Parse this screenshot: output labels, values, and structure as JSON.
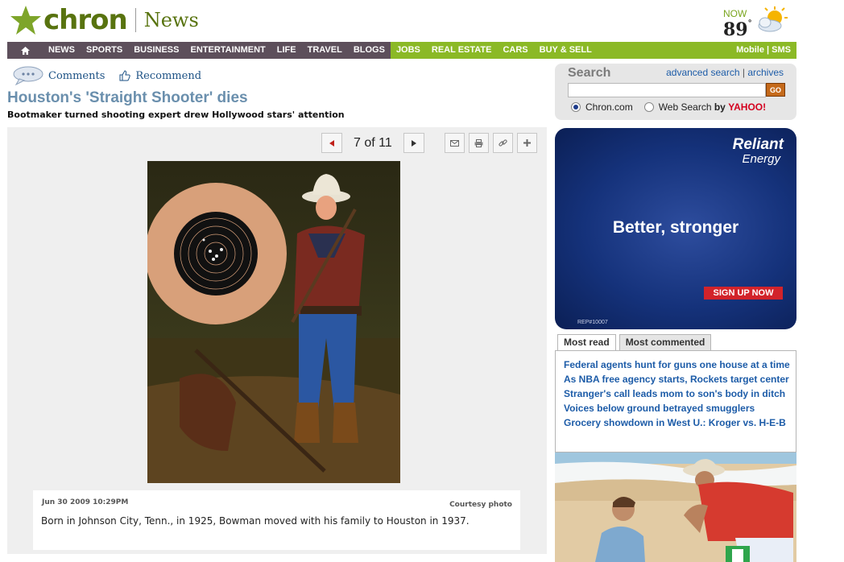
{
  "header": {
    "logo_text": "chron",
    "section": "News",
    "weather_label": "NOW",
    "weather_temp": "89",
    "weather_deg": "°",
    "weather_icon": "partly-sunny-icon"
  },
  "nav": {
    "left_items": [
      "NEWS",
      "SPORTS",
      "BUSINESS",
      "ENTERTAINMENT",
      "LIFE",
      "TRAVEL",
      "BLOGS"
    ],
    "right_items": [
      "JOBS",
      "REAL ESTATE",
      "CARS",
      "BUY & SELL"
    ],
    "mobile": "Mobile | SMS",
    "home_icon": "home-icon"
  },
  "tools": {
    "comments": "Comments",
    "recommend": "Recommend"
  },
  "article": {
    "headline": "Houston's 'Straight Shooter' dies",
    "deck": "Bootmaker turned shooting expert drew Hollywood stars' attention"
  },
  "gallery": {
    "count": "7 of 11",
    "caption_date": "Jun 30 2009 10:29PM",
    "caption_credit": "Courtesy photo",
    "caption_text": "Born in Johnson City, Tenn., in 1925, Bowman moved with his family to Houston in 1937."
  },
  "search": {
    "label": "Search",
    "advanced": "advanced search",
    "sep": "|",
    "archives": "archives",
    "go": "GO",
    "opt1": "Chron.com",
    "opt2": "Web Search",
    "by": "by",
    "yahoo": "YAHOO!"
  },
  "ad": {
    "brand1": "Reliant",
    "brand2": "Energy",
    "headline": "Better, stronger",
    "cta": "SIGN UP NOW",
    "code": "REP#10007"
  },
  "most": {
    "tab_read": "Most read",
    "tab_commented": "Most commented",
    "items": [
      "Federal agents hunt for guns one house at a time",
      "As NBA free agency starts, Rockets target center",
      "Stranger's call leads mom to son's body in ditch",
      "Voices below ground betrayed smugglers",
      "Grocery showdown in West U.: Kroger vs. H-E-B"
    ]
  },
  "colors": {
    "brand_green": "#58730f",
    "nav_purple": "#5d4f5b",
    "nav_green": "#8bb926",
    "headline_blue": "#6a8fad",
    "link_blue": "#1d5ca8"
  }
}
